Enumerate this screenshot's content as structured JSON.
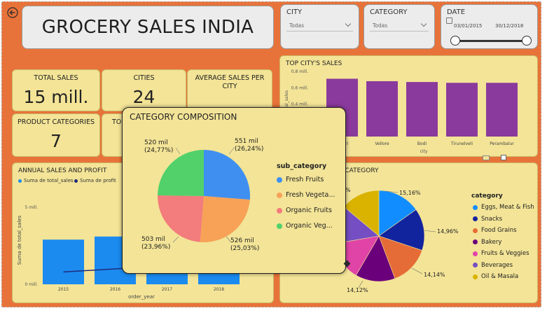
{
  "dashboard": {
    "title": "GROCERY SALES INDIA"
  },
  "filters": {
    "city": {
      "label": "CITY",
      "value": "Todas"
    },
    "category": {
      "label": "CATEGORY",
      "value": "Todas"
    },
    "date": {
      "label": "DATE",
      "start": "03/01/2015",
      "end": "30/12/2018",
      "range_start_fraction": 0,
      "range_end_fraction": 1
    }
  },
  "kpis": {
    "total_sales": {
      "label": "TOTAL SALES",
      "value": "15 mill."
    },
    "cities": {
      "label": "CITIES",
      "value": "24"
    },
    "avg_sales_city": {
      "label": "AVERAGE SALES PER CITY"
    },
    "product_categories": {
      "label": "PRODUCT CATEGORIES",
      "value": "7"
    },
    "hidden_card": {
      "label": "TO"
    }
  },
  "top_cities": {
    "title": "TOP CITY'S SALES",
    "ylabel": "total_sales",
    "xlabel": "city",
    "bar_color": "#8a3a9c"
  },
  "annual": {
    "title": "ANNUAL SALES AND PROFIT",
    "legend": [
      "Suma de total_sales",
      "Suma de profit"
    ],
    "ylabel": "Suma de total_sales",
    "xlabel": "order_year",
    "bar_color": "#1b8bf0",
    "line_color": "#1f2a7a"
  },
  "sales_by_category": {
    "title_fragment": "T CATEGORY",
    "legend_title": "category",
    "left_fragment": "%"
  },
  "popup": {
    "title": "CATEGORY COMPOSITION",
    "legend_title": "sub_category",
    "legend": [
      "Fresh Fruits",
      "Fresh Vegeta...",
      "Organic Fruits",
      "Organic Veg..."
    ]
  },
  "chart_data": [
    {
      "type": "bar",
      "title": "TOP CITY'S SALES",
      "xlabel": "city",
      "ylabel": "total_sales",
      "categories": [
        "Kanyakumari",
        "Vellore",
        "Bodi",
        "Tirunelveli",
        "Perambalur"
      ],
      "category_labels": [
        "umari",
        "Vellore",
        "Bodi",
        "Tirunelveli",
        "Perambalur"
      ],
      "values": [
        0.71,
        0.68,
        0.67,
        0.66,
        0.66
      ],
      "ylim": [
        0,
        0.8
      ],
      "yticks": [
        "0,8 mill.",
        "0,6 mill.",
        "0,4 mill."
      ],
      "ytick_values": [
        0.8,
        0.6,
        0.4
      ],
      "unit": "mill."
    },
    {
      "type": "bar",
      "title": "ANNUAL SALES AND PROFIT",
      "xlabel": "order_year",
      "ylabel": "Suma de total_sales",
      "categories": [
        "2015",
        "2016",
        "2017",
        "2018"
      ],
      "series": [
        {
          "name": "Suma de total_sales",
          "values": [
            2.9,
            3.1,
            3.6,
            4.5
          ]
        },
        {
          "name": "Suma de profit",
          "values": [
            0.8,
            1.0,
            1.2,
            1.4
          ]
        }
      ],
      "ylim": [
        0,
        5
      ],
      "yticks": [
        "5 mill.",
        "0 mill."
      ],
      "ytick_values": [
        5,
        0
      ]
    },
    {
      "type": "pie",
      "title": "CATEGORY COMPOSITION",
      "legend_title": "sub_category",
      "labels": [
        "Fresh Fruits",
        "Fresh Vegetables",
        "Organic Fruits",
        "Organic Vegetables"
      ],
      "values": [
        26.24,
        25.03,
        23.96,
        24.77
      ],
      "colors": [
        "#3f8ff0",
        "#f7a257",
        "#f37c7c",
        "#52d16b"
      ],
      "data_labels": [
        {
          "value": "551 mil",
          "pct": "(26,24%)"
        },
        {
          "value": "526 mil",
          "pct": "(25,03%)"
        },
        {
          "value": "503 mil",
          "pct": "(23,96%)"
        },
        {
          "value": "520 mil",
          "pct": "(24,77%)"
        }
      ]
    },
    {
      "type": "pie",
      "title": "T CATEGORY",
      "legend_title": "category",
      "labels": [
        "Eggs, Meat & Fish",
        "Snacks",
        "Food Grains",
        "Bakery",
        "Fruits & Veggies",
        "Beverages",
        "Oil & Masala"
      ],
      "values": [
        15.16,
        14.96,
        14.14,
        14.12,
        13.9,
        13.8,
        13.92
      ],
      "colors": [
        "#118dff",
        "#12239e",
        "#e66c37",
        "#6b007b",
        "#e044a7",
        "#744ec2",
        "#d9b300"
      ],
      "data_labels": [
        "15,16%",
        "14,96%",
        "14,14%",
        "14,12%"
      ]
    }
  ]
}
